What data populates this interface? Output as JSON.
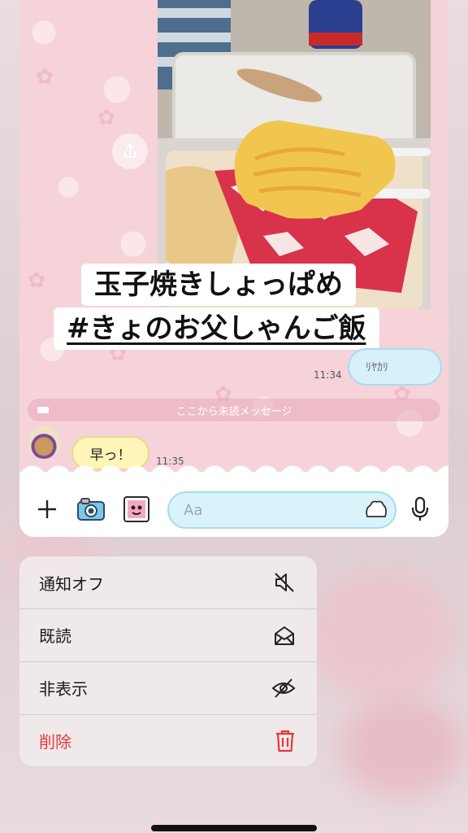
{
  "photo_caption": {
    "line1": "玉子焼きしょっぱめ",
    "line2": "#きょのお父しゃんご飯"
  },
  "chat": {
    "own_message_partial": "ﾘﾔｶﾘ",
    "own_time": "11:34",
    "unread_divider": "ここから未読メッセージ",
    "incoming_message": "早っ！",
    "incoming_time": "11:35"
  },
  "input_bar": {
    "placeholder": "Aa"
  },
  "icons": {
    "share": "share-icon",
    "plus": "plus-icon",
    "camera": "camera-icon",
    "sticker": "sticker-icon",
    "emoji": "emoji-icon",
    "mic": "mic-icon"
  },
  "context_menu": {
    "items": [
      {
        "label": "通知オフ",
        "icon": "mute-icon"
      },
      {
        "label": "既読",
        "icon": "envelope-open-icon"
      },
      {
        "label": "非表示",
        "icon": "eye-slash-icon"
      },
      {
        "label": "削除",
        "icon": "trash-icon",
        "color": "#e5383b"
      }
    ]
  }
}
